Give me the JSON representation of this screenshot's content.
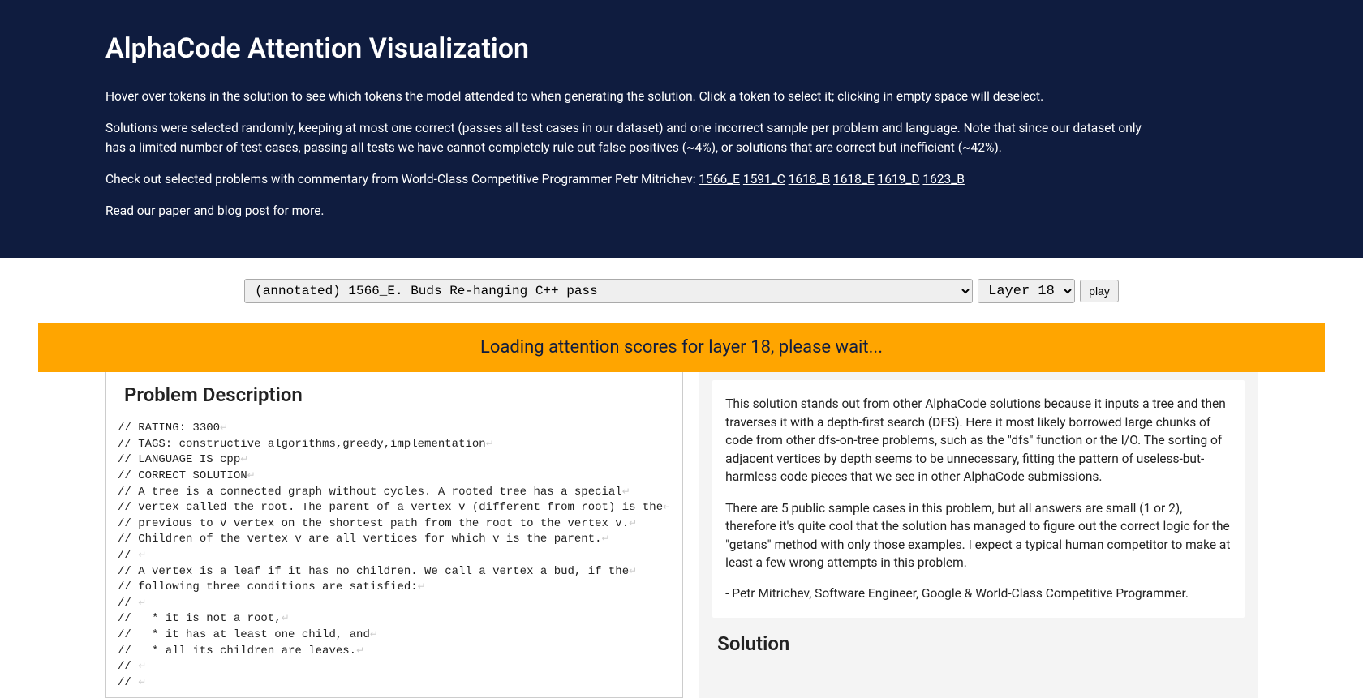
{
  "header": {
    "title": "AlphaCode Attention Visualization",
    "intro1": "Hover over tokens in the solution to see which tokens the model attended to when generating the solution. Click a token to select it; clicking in empty space will deselect.",
    "intro2": "Solutions were selected randomly, keeping at most one correct (passes all test cases in our dataset) and one incorrect sample per problem and language. Note that since our dataset only has a limited number of test cases, passing all tests we have cannot completely rule out false positives (~4%), or solutions that are correct but inefficient (~42%).",
    "checkout_prefix": "Check out selected problems with commentary from World-Class Competitive Programmer Petr Mitrichev: ",
    "links": {
      "l1566_E": "1566_E",
      "l1591_C": "1591_C",
      "l1618_B": "1618_B",
      "l1618_E": "1618_E",
      "l1619_D": "1619_D",
      "l1623_B": "1623_B"
    },
    "readour_prefix": "Read our ",
    "paper_link": "paper",
    "and_text": " and ",
    "blogpost_link": "blog post",
    "formore_text": " for more."
  },
  "controls": {
    "problem_selected": "(annotated) 1566_E. Buds Re-hanging              C++             pass",
    "layer_selected": "Layer 18",
    "play_label": "play"
  },
  "loading": {
    "message": "Loading attention scores for layer 18, please wait..."
  },
  "left": {
    "title": "Problem Description",
    "lines": [
      "// RATING: 3300",
      "// TAGS: constructive algorithms,greedy,implementation",
      "// LANGUAGE IS cpp",
      "// CORRECT SOLUTION",
      "// A tree is a connected graph without cycles. A rooted tree has a special",
      "// vertex called the root. The parent of a vertex v (different from root) is the",
      "// previous to v vertex on the shortest path from the root to the vertex v.",
      "// Children of the vertex v are all vertices for which v is the parent.",
      "// ",
      "// A vertex is a leaf if it has no children. We call a vertex a bud, if the",
      "// following three conditions are satisfied:",
      "// ",
      "//   * it is not a root,",
      "//   * it has at least one child, and",
      "//   * all its children are leaves.",
      "// ",
      "// "
    ]
  },
  "right": {
    "commentary_p1": "This solution stands out from other AlphaCode solutions because it inputs a tree and then traverses it with a depth-first search (DFS). Here it most likely borrowed large chunks of code from other dfs-on-tree problems, such as the \"dfs\" function or the I/O. The sorting of adjacent vertices by depth seems to be unnecessary, fitting the pattern of useless-but-harmless code pieces that we see in other AlphaCode submissions.",
    "commentary_p2": "There are 5 public sample cases in this problem, but all answers are small (1 or 2), therefore it's quite cool that the solution has managed to figure out the correct logic for the \"getans\" method with only those examples. I expect a typical human competitor to make at least a few wrong attempts in this problem.",
    "commentary_p3": "- Petr Mitrichev, Software Engineer, Google & World-Class Competitive Programmer.",
    "solution_title": "Solution"
  }
}
